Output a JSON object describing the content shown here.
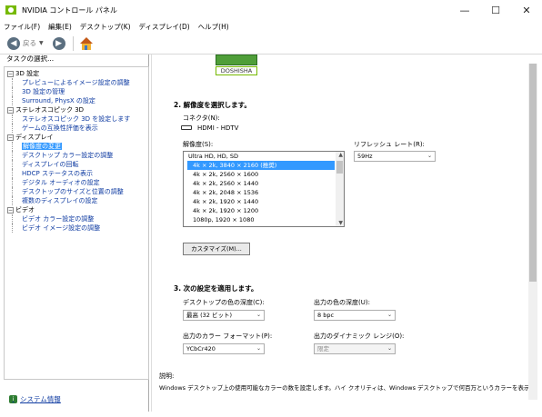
{
  "window": {
    "title": "NVIDIA コントロール パネル",
    "controls": [
      "—",
      "☐",
      "✕"
    ]
  },
  "menu": [
    "ファイル(F)",
    "編集(E)",
    "デスクトップ(K)",
    "ディスプレイ(D)",
    "ヘルプ(H)"
  ],
  "toolbar": {
    "back_label": "戻る"
  },
  "sidebar": {
    "header": "タスクの選択...",
    "tree": [
      {
        "label": "3D 設定",
        "type": "category"
      },
      {
        "label": "プレビューによるイメージ設定の調整",
        "type": "link"
      },
      {
        "label": "3D 設定の管理",
        "type": "link"
      },
      {
        "label": "Surround, PhysX の設定",
        "type": "link"
      },
      {
        "label": "ステレオスコピック 3D",
        "type": "category"
      },
      {
        "label": "ステレオスコピック 3D を設定します",
        "type": "link"
      },
      {
        "label": "ゲームの互換性評価を表示",
        "type": "link"
      },
      {
        "label": "ディスプレイ",
        "type": "category"
      },
      {
        "label": "解像度の変更",
        "type": "link",
        "selected": true
      },
      {
        "label": "デスクトップ カラー設定の調整",
        "type": "link"
      },
      {
        "label": "ディスプレイの回転",
        "type": "link"
      },
      {
        "label": "HDCP ステータスの表示",
        "type": "link"
      },
      {
        "label": "デジタル オーディオの設定",
        "type": "link"
      },
      {
        "label": "デスクトップのサイズと位置の調整",
        "type": "link"
      },
      {
        "label": "複数のディスプレイの設定",
        "type": "link"
      },
      {
        "label": "ビデオ",
        "type": "category"
      },
      {
        "label": "ビデオ カラー設定の調整",
        "type": "link"
      },
      {
        "label": "ビデオ イメージ設定の調整",
        "type": "link"
      }
    ],
    "system_info": "システム情報"
  },
  "main": {
    "monitor_label": "DOSHISHA",
    "section2_title": "2. 解像度を選択します。",
    "connector_label": "コネクタ(N):",
    "connector_value": "HDMI - HDTV",
    "resolution_label": "解像度(S):",
    "resolution_items": [
      "Ultra HD, HD, SD",
      "4k × 2k, 3840 × 2160 (推奨)",
      "4k × 2k, 2560 × 1600",
      "4k × 2k, 2560 × 1440",
      "4k × 2k, 2048 × 1536",
      "4k × 2k, 1920 × 1440",
      "4k × 2k, 1920 × 1200",
      "1080p, 1920 × 1080"
    ],
    "selected_resolution_index": 1,
    "refresh_label": "リフレッシュ レート(R):",
    "refresh_value": "59Hz",
    "customize_button": "カスタマイズ(M)...",
    "section3_title": "3. 次の設定を適用します。",
    "desktop_color_depth_label": "デスクトップの色の深度(C):",
    "desktop_color_depth_value": "最高 (32 ビット)",
    "output_color_depth_label": "出力の色の深度(U):",
    "output_color_depth_value": "8 bpc",
    "output_color_format_label": "出力のカラー フォーマット(P):",
    "output_color_format_value": "YCbCr420",
    "output_dynamic_range_label": "出力のダイナミック レンジ(O):",
    "output_dynamic_range_value": "限定",
    "description_heading": "説明:",
    "description_text": "Windows デスクトップ上の使用可能なカラーの数を設定します。ハイ クオリティは、Windows デスクトップで何百万というカラーを表示"
  }
}
